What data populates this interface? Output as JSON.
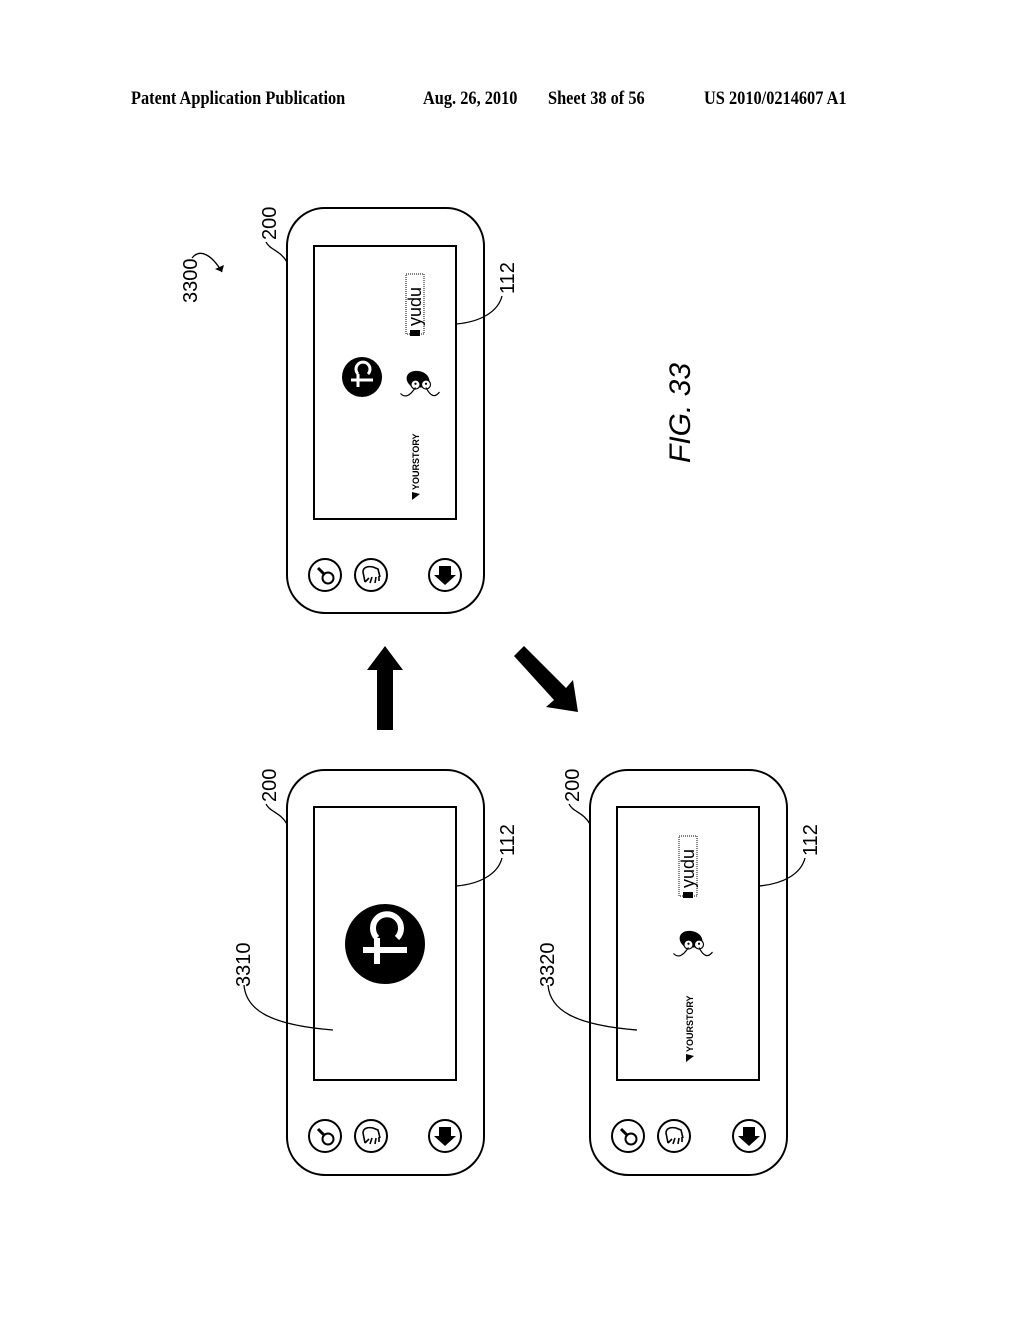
{
  "header": {
    "publication": "Patent Application Publication",
    "date": "Aug. 26, 2010",
    "sheet": "Sheet 38 of 56",
    "patent_number": "US 2010/0214607 A1"
  },
  "figure": {
    "label": "FIG. 33",
    "reference": "3300",
    "devices": [
      {
        "id": "top",
        "device_ref": "200",
        "screen_ref": "112",
        "state_ref": "",
        "screen_content": [
          "power-logo",
          "character-logo",
          "yudu-logo",
          "yourstory-logo"
        ]
      },
      {
        "id": "bottom-left",
        "device_ref": "200",
        "screen_ref": "112",
        "state_ref": "3310",
        "screen_content": [
          "power-logo"
        ]
      },
      {
        "id": "bottom-right",
        "device_ref": "200",
        "screen_ref": "112",
        "state_ref": "3320",
        "screen_content": [
          "character-logo",
          "yudu-logo",
          "yourstory-logo"
        ]
      }
    ],
    "logos": {
      "yudu": "yudu",
      "yourstory": "YOURSTORY"
    },
    "buttons": [
      {
        "icon": "magnifier-icon"
      },
      {
        "icon": "hand-icon"
      },
      {
        "icon": "back-arrow-icon"
      }
    ],
    "transitions": [
      {
        "from": "bottom-left",
        "to": "top",
        "direction": "up"
      },
      {
        "from": "top",
        "to": "bottom-right",
        "direction": "down-right"
      }
    ]
  }
}
